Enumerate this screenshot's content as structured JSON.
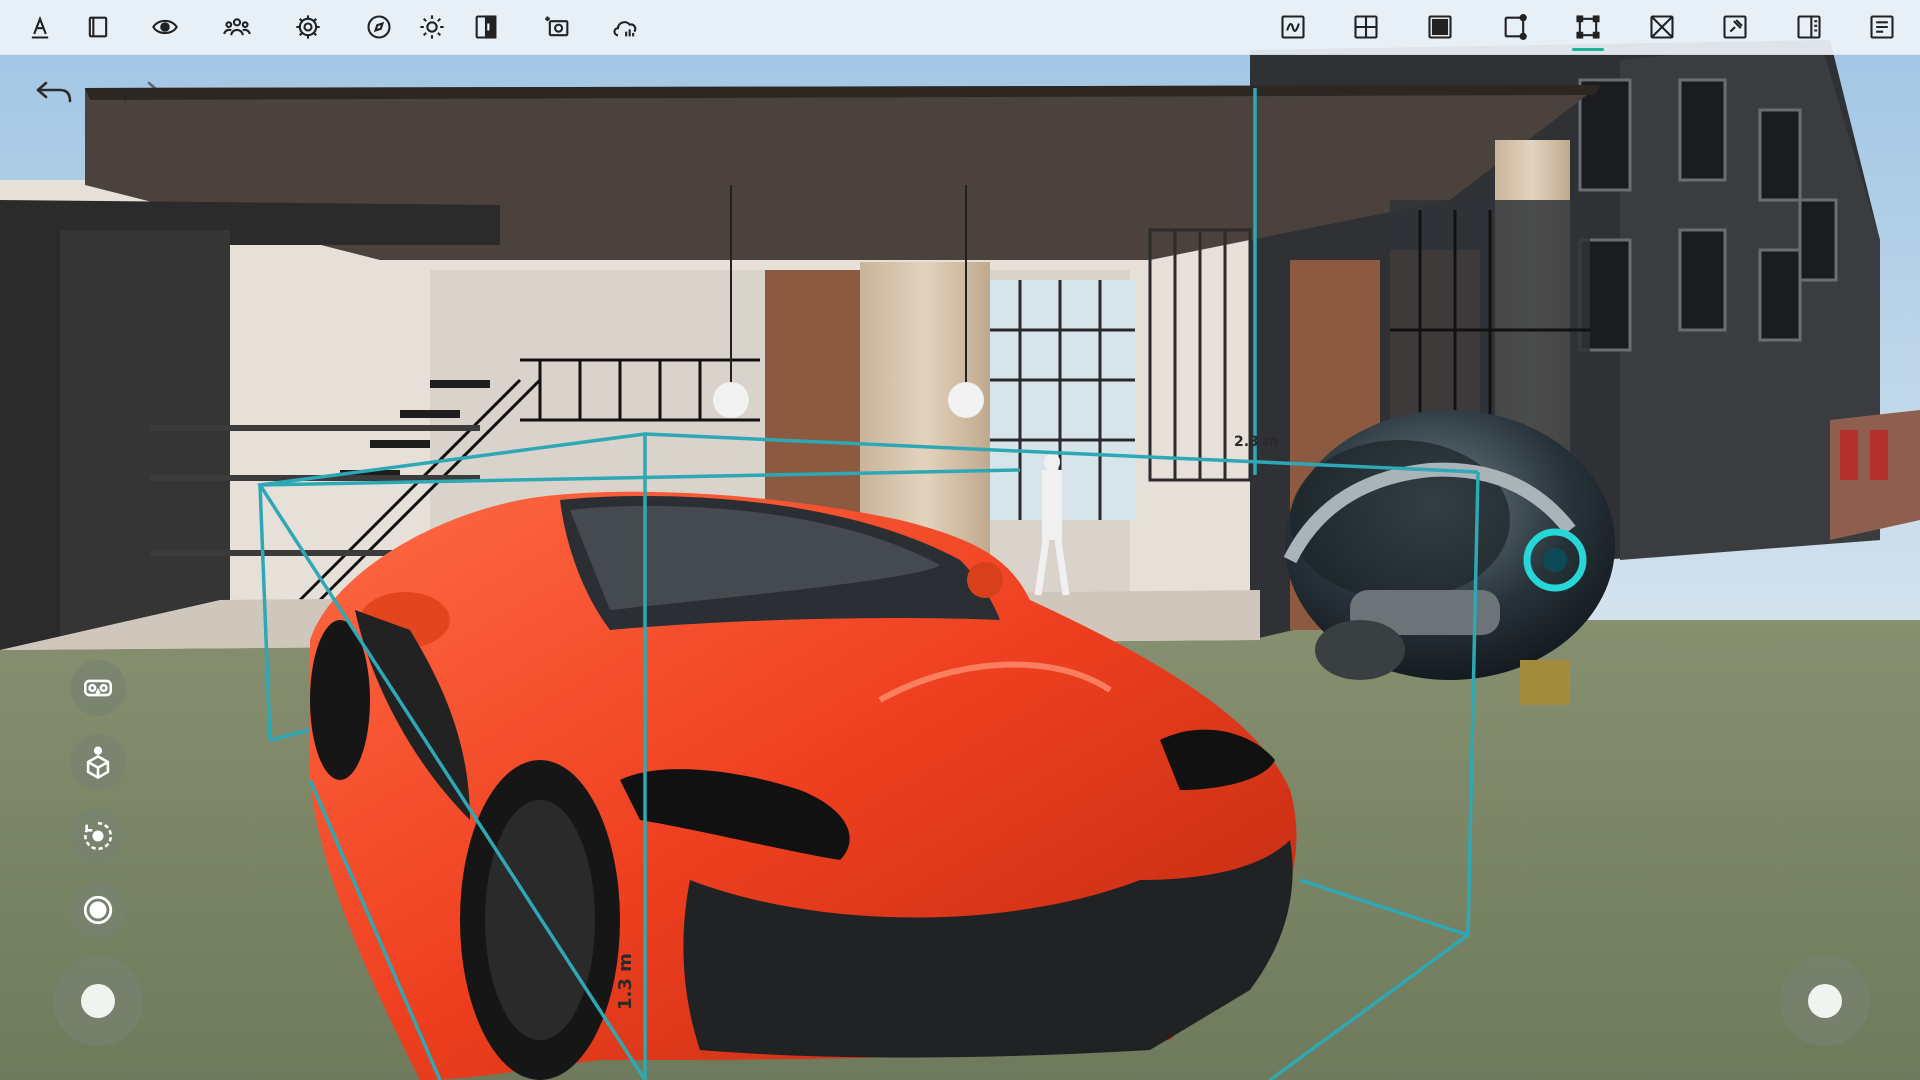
{
  "toolbar": {
    "left_tools": [
      {
        "icon": "text-baseline-icon",
        "name": "tool-annotate"
      },
      {
        "icon": "frame-icon",
        "name": "tool-frame"
      },
      {
        "icon": "eye-icon",
        "name": "tool-visibility"
      },
      {
        "icon": "people-icon",
        "name": "tool-collaborators"
      },
      {
        "icon": "gear-icon",
        "name": "tool-settings"
      },
      {
        "icon": "compass-icon",
        "name": "tool-navigation"
      },
      {
        "icon": "sun-icon",
        "name": "tool-lighting"
      },
      {
        "icon": "split-view-icon",
        "name": "tool-split-view"
      },
      {
        "icon": "camera-add-icon",
        "name": "tool-camera"
      },
      {
        "icon": "cloud-stats-icon",
        "name": "tool-cloud"
      }
    ],
    "right_tools": [
      {
        "icon": "texture-icon",
        "name": "mode-texture"
      },
      {
        "icon": "grid-icon",
        "name": "mode-grid"
      },
      {
        "icon": "solid-icon",
        "name": "mode-solid"
      },
      {
        "icon": "box-corner-icon",
        "name": "mode-box-corner"
      },
      {
        "icon": "bounding-box-icon",
        "name": "mode-bounding-box"
      },
      {
        "icon": "wireframe-cross-icon",
        "name": "mode-wireframe"
      },
      {
        "icon": "pin-box-icon",
        "name": "mode-pin"
      },
      {
        "icon": "panel-right-icon",
        "name": "mode-side-panel"
      },
      {
        "icon": "document-list-icon",
        "name": "mode-properties"
      }
    ],
    "active_tool": "mode-bounding-box",
    "accent_color": "#1fb39a"
  },
  "history": {
    "undo_icon": "undo-arrow-icon",
    "redo_icon": "redo-arrow-icon"
  },
  "side_tools": [
    {
      "icon": "vr-headset-icon",
      "name": "vr-mode-button"
    },
    {
      "icon": "person-ar-icon",
      "name": "ar-placement-button"
    },
    {
      "icon": "orbit-icon",
      "name": "orbit-mode-button"
    },
    {
      "icon": "record-icon",
      "name": "record-button"
    }
  ],
  "measurements": {
    "height_label": "1.3 m",
    "width_label": "2.3 m",
    "box_color": "#2ea8b5"
  },
  "scene_objects": [
    "sports-car",
    "robot-helmet",
    "loft-building",
    "brick-street"
  ]
}
